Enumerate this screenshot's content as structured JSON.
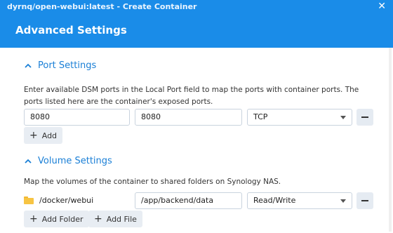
{
  "window": {
    "title": "dyrnq/open-webui:latest - Create Container"
  },
  "page": {
    "heading": "Advanced Settings"
  },
  "port_settings": {
    "label": "Port Settings",
    "description": "Enter available DSM ports in the Local Port field to map the ports with container ports. The ports listed here are the container's exposed ports.",
    "rows": [
      {
        "local_port": "8080",
        "container_port": "8080",
        "protocol": "TCP"
      }
    ],
    "add_label": "Add"
  },
  "volume_settings": {
    "label": "Volume Settings",
    "description": "Map the volumes of the container to shared folders on Synology NAS.",
    "rows": [
      {
        "folder": "/docker/webui",
        "mount_path": "/app/backend/data",
        "mode": "Read/Write"
      }
    ],
    "add_folder_label": "Add Folder",
    "add_file_label": "Add File"
  },
  "colors": {
    "header": "#1a8ce8",
    "accent": "#1a7fd6"
  }
}
